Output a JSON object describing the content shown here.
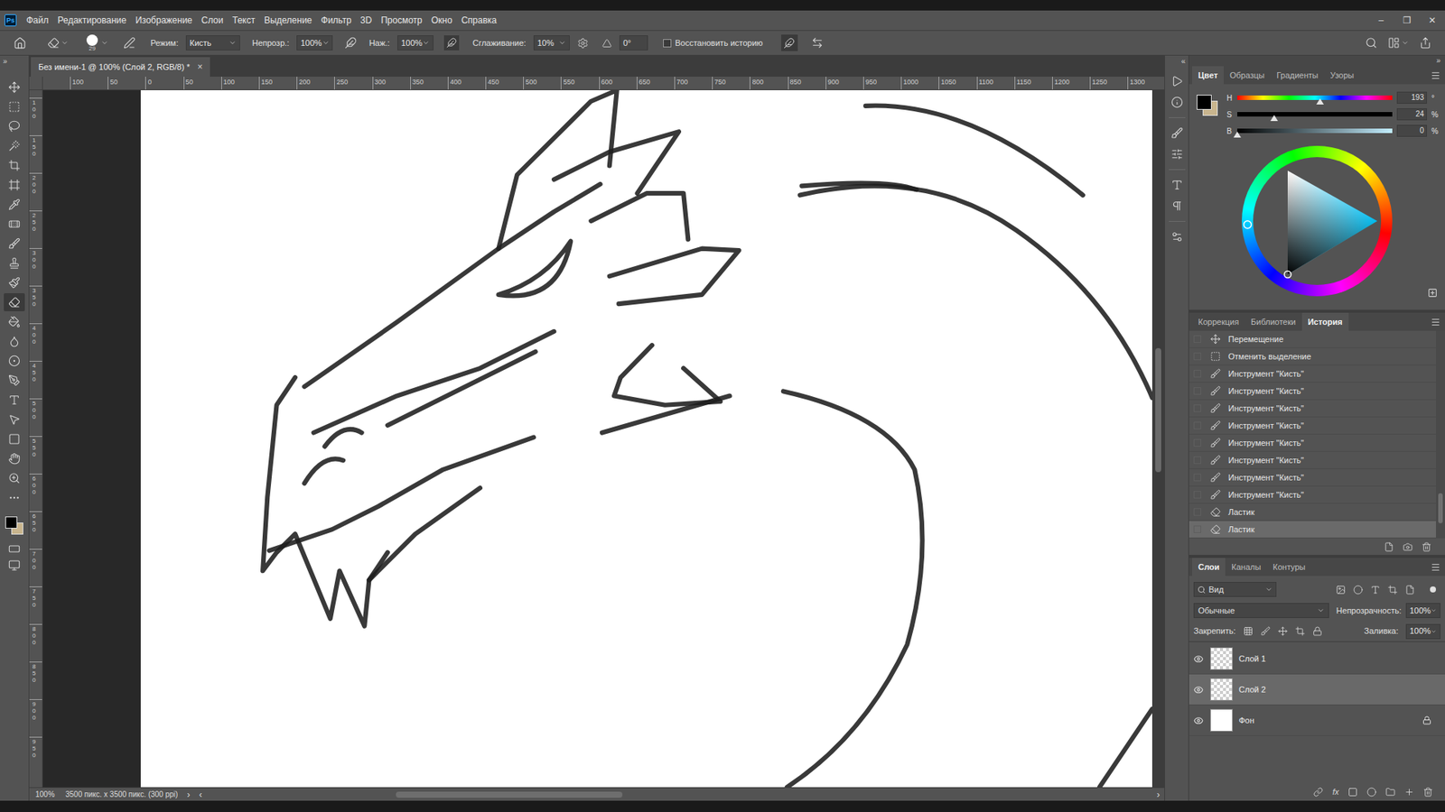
{
  "app": {
    "logo": "Ps",
    "menu": [
      "Файл",
      "Редактирование",
      "Изображение",
      "Слои",
      "Текст",
      "Выделение",
      "Фильтр",
      "3D",
      "Просмотр",
      "Окно",
      "Справка"
    ],
    "window_controls": [
      "–",
      "❐",
      "✕"
    ]
  },
  "options": {
    "brush_size": "29",
    "mode_label": "Режим:",
    "mode": "Кисть",
    "opacity_label": "Непрозр.:",
    "opacity": "100%",
    "flow_label": "Наж.:",
    "flow": "100%",
    "smoothing_label": "Сглаживание:",
    "smoothing": "10%",
    "angle": "0°",
    "restore_history": {
      "label": "Восстановить историю",
      "checked": false
    }
  },
  "toggles": {
    "toolbar": "»",
    "icon_column": "«",
    "panels": "»"
  },
  "tools": [
    {
      "tool": "move",
      "selected": false
    },
    {
      "tool": "marquee",
      "selected": false
    },
    {
      "tool": "lasso",
      "selected": false
    },
    {
      "tool": "quick-select",
      "selected": false
    },
    {
      "tool": "crop",
      "selected": false
    },
    {
      "tool": "frame",
      "selected": false
    },
    {
      "tool": "eyedropper",
      "selected": false
    },
    {
      "tool": "healing",
      "selected": false
    },
    {
      "tool": "brush",
      "selected": false
    },
    {
      "tool": "stamp",
      "selected": false
    },
    {
      "tool": "history-brush",
      "selected": false
    },
    {
      "tool": "eraser",
      "selected": true
    },
    {
      "tool": "bucket",
      "selected": false
    },
    {
      "tool": "blur",
      "selected": false
    },
    {
      "tool": "dodge",
      "selected": false
    },
    {
      "tool": "pen",
      "selected": false
    },
    {
      "tool": "type",
      "selected": false
    },
    {
      "tool": "path-select",
      "selected": false
    },
    {
      "tool": "shape",
      "selected": false
    },
    {
      "tool": "hand",
      "selected": false
    },
    {
      "tool": "zoom",
      "selected": false
    },
    {
      "tool": "more",
      "selected": false
    }
  ],
  "document_tab": {
    "title": "Без имени-1 @ 100% (Слой 2, RGB/8) *",
    "close": "×"
  },
  "rulers": {
    "horizontal": [
      "100",
      "50",
      "0",
      "50",
      "100",
      "150",
      "200",
      "250",
      "300",
      "350",
      "400",
      "450",
      "500",
      "550",
      "600",
      "650",
      "700",
      "750",
      "800",
      "850",
      "900",
      "950",
      "1000",
      "1050",
      "1100",
      "1150",
      "1200",
      "1250",
      "1300"
    ],
    "vertical": [
      "100",
      "150",
      "200",
      "250",
      "300",
      "350",
      "400",
      "450",
      "500",
      "550",
      "600",
      "650",
      "700",
      "750",
      "800",
      "850",
      "900",
      "950"
    ]
  },
  "scroll": {
    "vertical_position": 0.37,
    "horizontal_position": 0.2
  },
  "status_bar": {
    "zoom": "100%",
    "info": "3500 пикс. x 3500 пикс. (300 ppi)",
    "arrows": [
      "›",
      "‹",
      "›"
    ]
  },
  "color_panel": {
    "tabs": [
      {
        "label": "Цвет",
        "selected": true
      },
      {
        "label": "Образцы",
        "selected": false
      },
      {
        "label": "Градиенты",
        "selected": false
      },
      {
        "label": "Узоры",
        "selected": false
      }
    ],
    "channels": [
      {
        "label": "H",
        "value": "193",
        "unit": "°",
        "level": 0.536
      },
      {
        "label": "S",
        "value": "24",
        "unit": "%",
        "level": 0.24
      },
      {
        "label": "B",
        "value": "0",
        "unit": "%",
        "level": 0
      }
    ],
    "foreground": "#000000",
    "background": "#c9b58e"
  },
  "history_panel": {
    "tabs": [
      {
        "label": "Коррекция",
        "selected": false
      },
      {
        "label": "Библиотеки",
        "selected": false
      },
      {
        "label": "История",
        "selected": true
      }
    ],
    "items": [
      {
        "label": "Перемещение",
        "kind": "move",
        "selected": false
      },
      {
        "label": "Отменить выделение",
        "kind": "deselect",
        "selected": false
      },
      {
        "label": "Инструмент \"Кисть\"",
        "kind": "brush",
        "selected": false
      },
      {
        "label": "Инструмент \"Кисть\"",
        "kind": "brush",
        "selected": false
      },
      {
        "label": "Инструмент \"Кисть\"",
        "kind": "brush",
        "selected": false
      },
      {
        "label": "Инструмент \"Кисть\"",
        "kind": "brush",
        "selected": false
      },
      {
        "label": "Инструмент \"Кисть\"",
        "kind": "brush",
        "selected": false
      },
      {
        "label": "Инструмент \"Кисть\"",
        "kind": "brush",
        "selected": false
      },
      {
        "label": "Инструмент \"Кисть\"",
        "kind": "brush",
        "selected": false
      },
      {
        "label": "Инструмент \"Кисть\"",
        "kind": "brush",
        "selected": false
      },
      {
        "label": "Ластик",
        "kind": "eraser",
        "selected": false
      },
      {
        "label": "Ластик",
        "kind": "eraser",
        "selected": true
      }
    ]
  },
  "layers_panel": {
    "tabs": [
      {
        "label": "Слои",
        "selected": true
      },
      {
        "label": "Каналы",
        "selected": false
      },
      {
        "label": "Контуры",
        "selected": false
      }
    ],
    "filter": "Вид",
    "blend_mode": "Обычные",
    "opacity_label": "Непрозрачность:",
    "opacity": "100%",
    "lock_label": "Закрепить:",
    "fill_label": "Заливка:",
    "fill": "100%",
    "layers": [
      {
        "name": "Слой 1",
        "visible": true,
        "selected": false,
        "locked": false,
        "kind": "transparent"
      },
      {
        "name": "Слой 2",
        "visible": true,
        "selected": true,
        "locked": false,
        "kind": "transparent"
      },
      {
        "name": "Фон",
        "visible": true,
        "selected": false,
        "locked": true,
        "kind": "white"
      }
    ],
    "footer_fx": "fx"
  }
}
